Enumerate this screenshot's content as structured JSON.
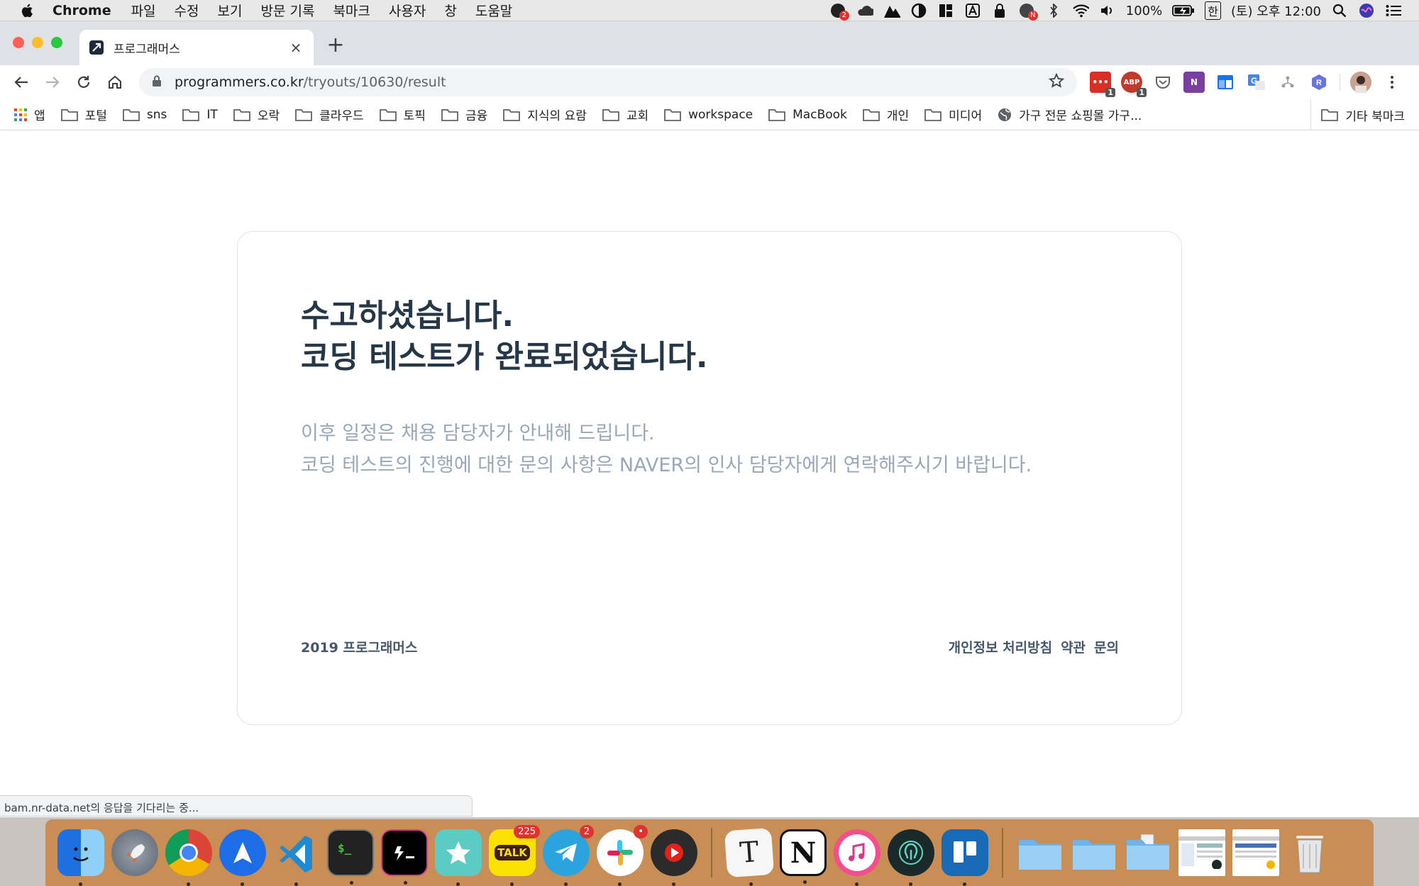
{
  "menubar": {
    "app": "Chrome",
    "items": [
      "파일",
      "수정",
      "보기",
      "방문 기록",
      "북마크",
      "사용자",
      "창",
      "도움말"
    ],
    "battery": "100%",
    "input_method": "한",
    "clock": "(토) 오후 12:00"
  },
  "tab": {
    "title": "프로그래머스",
    "close": "×",
    "new_tab": "+"
  },
  "omnibox": {
    "host": "programmers.co.kr",
    "path": "/tryouts/10630/result"
  },
  "extensions": [
    {
      "icon": "todo-extension-icon",
      "color": "#d93025",
      "badge": "1"
    },
    {
      "icon": "adblock-icon",
      "color": "#c0392b",
      "label": "ABP",
      "badge": "1"
    },
    {
      "icon": "pocket-icon",
      "color": "#5f6368"
    },
    {
      "icon": "onenote-icon",
      "color": "#7b3fa0",
      "label": "N"
    },
    {
      "icon": "window-extension-icon",
      "color": "#1a73e8"
    },
    {
      "icon": "translate-icon",
      "color": "#4285f4"
    },
    {
      "icon": "network-icon",
      "color": "#9aa0a6"
    },
    {
      "icon": "r-extension-icon",
      "color": "#6674e6",
      "label": "R"
    }
  ],
  "bookmarks": {
    "apps": "앱",
    "folders": [
      "포털",
      "sns",
      "IT",
      "오락",
      "클라우드",
      "토픽",
      "금융",
      "지식의 요람",
      "교회",
      "workspace",
      "MacBook",
      "개인",
      "미디어"
    ],
    "site": "가구 전문 쇼핑몰 가구...",
    "other": "기타 북마크"
  },
  "page": {
    "headline_line1": "수고하셨습니다.",
    "headline_line2": "코딩 테스트가 완료되었습니다.",
    "sub_line1": "이후 일정은 채용 담당자가 안내해 드립니다.",
    "sub_line2": "코딩 테스트의 진행에 대한 문의 사항은 NAVER의 인사 담당자에게 연락해주시기 바랍니다.",
    "footer_copyright": "2019 프로그래머스",
    "footer_links": [
      "개인정보 처리방침",
      "약관",
      "문의"
    ]
  },
  "status_text": "bam.nr-data.net의 응답을 기다리는 중...",
  "colors": {
    "headline": "#263747",
    "subtext": "#98a8b9",
    "footer": "#44576c",
    "card_border": "#dfe3e8"
  },
  "dock": {
    "kakaotalk_label": "TALK",
    "kakaotalk_badge": "225",
    "telegram_badge": "2",
    "typora_letter": "T",
    "notion_letter": "N"
  }
}
